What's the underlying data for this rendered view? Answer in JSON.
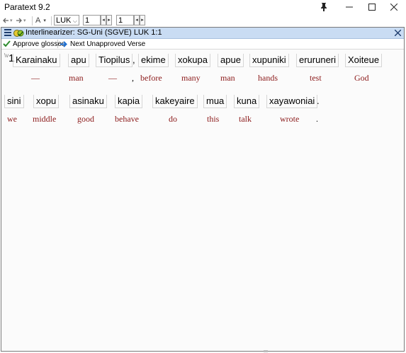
{
  "window": {
    "title": "Paratext 9.2",
    "buttons": {
      "pin": "📌",
      "minimize": "—",
      "maximize": "☐",
      "close": "✕"
    }
  },
  "toolbar": {
    "back": "←",
    "forward": "→",
    "font_label": "A",
    "book": "LUK",
    "chapter": "1",
    "verse": "1"
  },
  "panel": {
    "title": "Interlinearizer: SG-Uni (SGVE) LUK 1:1",
    "close": "✕"
  },
  "actions": {
    "approve": "Approve glosses",
    "next": "Next Unapproved Verse"
  },
  "verse": {
    "number": "1",
    "marker": "\\v",
    "line1": [
      {
        "word": "Karainaku",
        "gloss": "—"
      },
      {
        "word": "apu",
        "gloss": "man"
      },
      {
        "word": "Tiopilus",
        "gloss": "—"
      },
      {
        "word": ",",
        "gloss": ","
      },
      {
        "word": "ekime",
        "gloss": "before"
      },
      {
        "word": "xokupa",
        "gloss": "many"
      },
      {
        "word": "apue",
        "gloss": "man"
      },
      {
        "word": "xupuniki",
        "gloss": "hands"
      },
      {
        "word": "eruruneri",
        "gloss": "test"
      },
      {
        "word": "Xoiteue",
        "gloss": "God"
      }
    ],
    "line2": [
      {
        "word": "sini",
        "gloss": "we"
      },
      {
        "word": "xopu",
        "gloss": "middle"
      },
      {
        "word": "asinaku",
        "gloss": "good"
      },
      {
        "word": "kapia",
        "gloss": "behave"
      },
      {
        "word": "kakeyaire",
        "gloss": "do"
      },
      {
        "word": "mua",
        "gloss": "this"
      },
      {
        "word": "kuna",
        "gloss": "talk"
      },
      {
        "word": "xayawoniai",
        "gloss": "wrote"
      },
      {
        "word": ".",
        "gloss": "."
      }
    ]
  },
  "colors": {
    "gloss": "#8b1a1a",
    "panel_header": "#c9dcf3",
    "approve_check": "#2e8b2e",
    "next_arrow": "#1f6fd0"
  }
}
